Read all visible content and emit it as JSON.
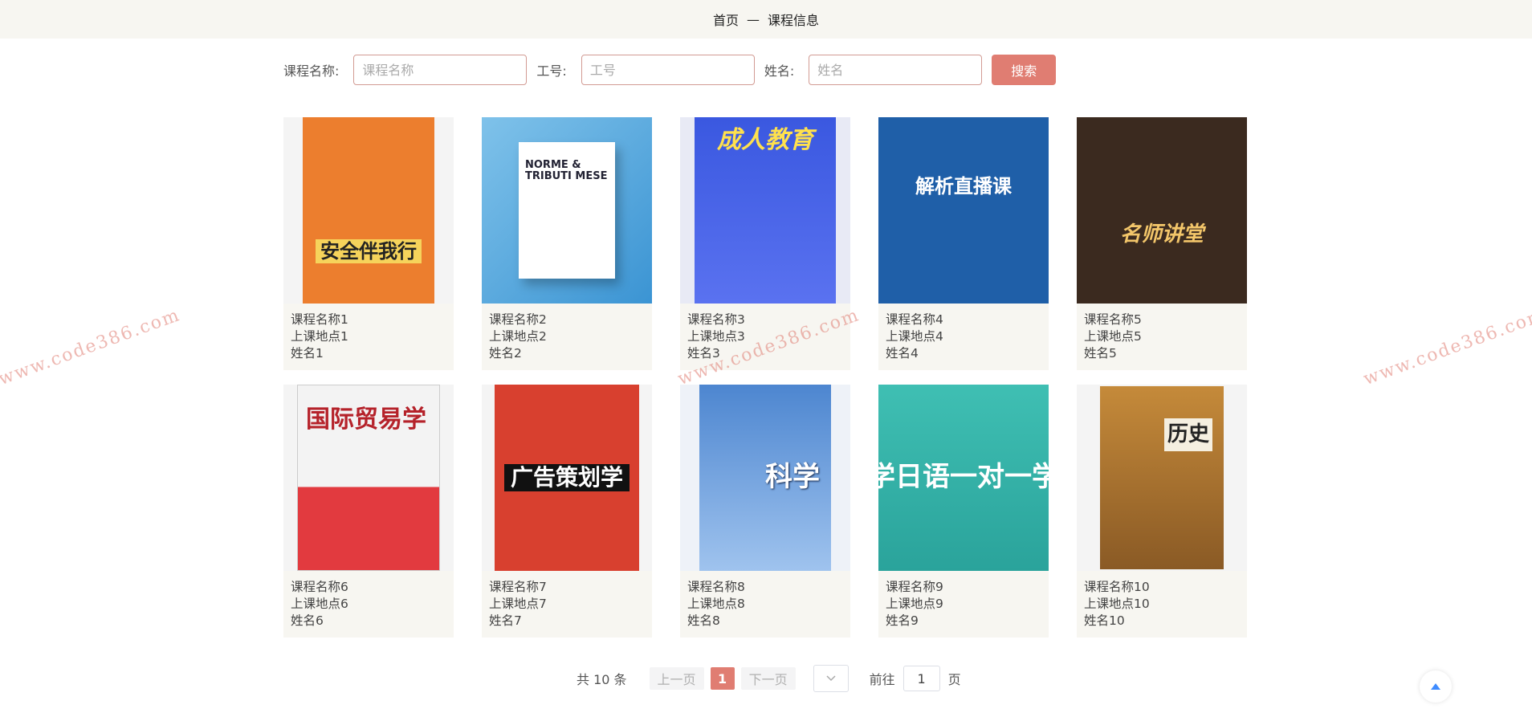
{
  "header": {
    "home": "首页",
    "separator": "—",
    "current": "课程信息"
  },
  "search": {
    "fields": [
      {
        "label": "课程名称:",
        "placeholder": "课程名称",
        "value": ""
      },
      {
        "label": "工号:",
        "placeholder": "工号",
        "value": ""
      },
      {
        "label": "姓名:",
        "placeholder": "姓名",
        "value": ""
      }
    ],
    "button": "搜索"
  },
  "courses": [
    {
      "name": "课程名称1",
      "location": "上课地点1",
      "teacher": "姓名1",
      "cover_text": "安全伴我行"
    },
    {
      "name": "课程名称2",
      "location": "上课地点2",
      "teacher": "姓名2",
      "cover_text": "NORME & TRIBUTI MESE"
    },
    {
      "name": "课程名称3",
      "location": "上课地点3",
      "teacher": "姓名3",
      "cover_text": "成人教育"
    },
    {
      "name": "课程名称4",
      "location": "上课地点4",
      "teacher": "姓名4",
      "cover_text": "解析直播课"
    },
    {
      "name": "课程名称5",
      "location": "上课地点5",
      "teacher": "姓名5",
      "cover_text": "名师讲堂"
    },
    {
      "name": "课程名称6",
      "location": "上课地点6",
      "teacher": "姓名6",
      "cover_text": "国际贸易学"
    },
    {
      "name": "课程名称7",
      "location": "上课地点7",
      "teacher": "姓名7",
      "cover_text": "广告策划学"
    },
    {
      "name": "课程名称8",
      "location": "上课地点8",
      "teacher": "姓名8",
      "cover_text": "科学"
    },
    {
      "name": "课程名称9",
      "location": "上课地点9",
      "teacher": "姓名9",
      "cover_text": "学日语一对一学"
    },
    {
      "name": "课程名称10",
      "location": "上课地点10",
      "teacher": "姓名10",
      "cover_text": "历史"
    }
  ],
  "pagination": {
    "total": "共 10 条",
    "prev": "上一页",
    "current_page": "1",
    "next": "下一页",
    "size_icon": "chevron-down-icon",
    "goto": "前往",
    "goto_value": "1",
    "page_unit": "页"
  },
  "backtop_icon": "arrow-up-icon",
  "watermark": "www.code386.com",
  "colors": {
    "accent": "#e07d72",
    "header_bg": "#f7f6f1",
    "card_bg": "#f7f6f1"
  }
}
